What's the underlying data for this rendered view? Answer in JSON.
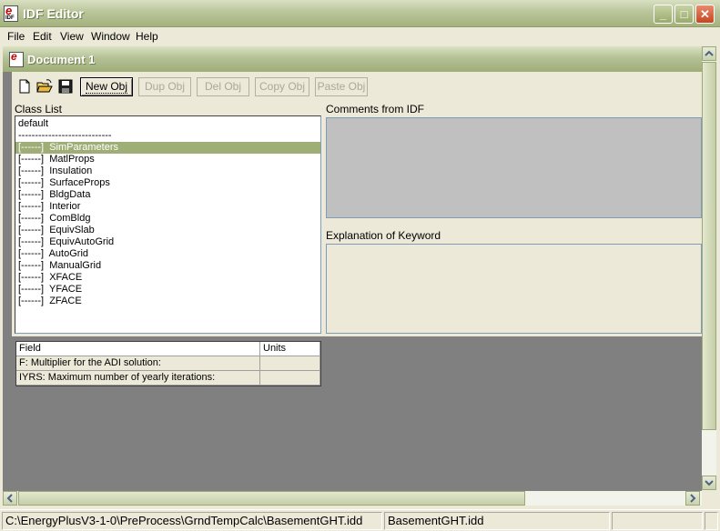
{
  "app": {
    "title": "IDF Editor"
  },
  "menu": [
    "File",
    "Edit",
    "View",
    "Window",
    "Help"
  ],
  "document": {
    "title": "Document 1"
  },
  "toolbar": {
    "new_obj": "New Obj",
    "dup_obj": "Dup Obj",
    "del_obj": "Del Obj",
    "copy_obj": "Copy Obj",
    "paste_obj": "Paste Obj",
    "icons": [
      "new-file-icon",
      "open-folder-icon",
      "save-disk-icon"
    ]
  },
  "class_list": {
    "label": "Class List",
    "items": [
      "default",
      "----------------------------",
      "[------]  SimParameters",
      "[------]  MatlProps",
      "[------]  Insulation",
      "[------]  SurfaceProps",
      "[------]  BldgData",
      "[------]  Interior",
      "[------]  ComBldg",
      "[------]  EquivSlab",
      "[------]  EquivAutoGrid",
      "[------]  AutoGrid",
      "[------]  ManualGrid",
      "[------]  XFACE",
      "[------]  YFACE",
      "[------]  ZFACE"
    ],
    "selected_index": 2
  },
  "comments": {
    "label": "Comments from IDF"
  },
  "explanation": {
    "label": "Explanation of Keyword"
  },
  "grid": {
    "headers": [
      "Field",
      "Units"
    ],
    "rows": [
      [
        "F: Multiplier for the ADI solution:",
        ""
      ],
      [
        "IYRS: Maximum number of yearly iterations:",
        ""
      ]
    ]
  },
  "status": {
    "path": "C:\\EnergyPlusV3-1-0\\PreProcess\\GrndTempCalc\\BasementGHT.idd",
    "file": "BasementGHT.idd"
  },
  "colors": {
    "title_bar": "#a4b27e",
    "selection": "#9fae77",
    "mdi_background": "#808080"
  }
}
